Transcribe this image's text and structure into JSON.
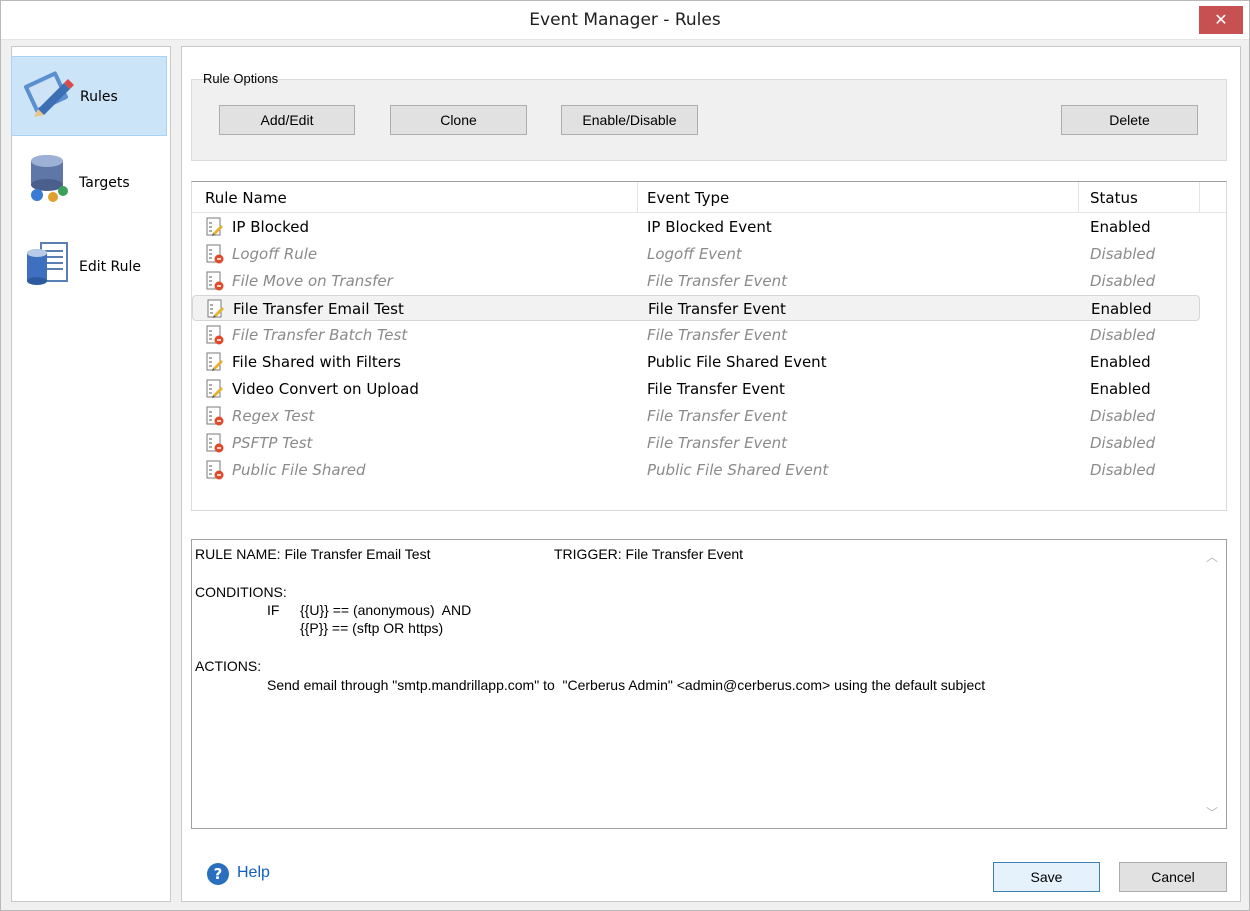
{
  "window": {
    "title": "Event Manager - Rules",
    "close_glyph": "✕"
  },
  "sidebar": {
    "items": [
      {
        "label": "Rules",
        "icon": "rules-pen-icon",
        "active": true
      },
      {
        "label": "Targets",
        "icon": "targets-database-icon",
        "active": false
      },
      {
        "label": "Edit Rule",
        "icon": "edit-rule-document-icon",
        "active": false
      }
    ]
  },
  "rule_options": {
    "group_label": "Rule Options",
    "add_edit": "Add/Edit",
    "clone": "Clone",
    "enable_disable": "Enable/Disable",
    "delete": "Delete"
  },
  "rules_list": {
    "columns": [
      "Rule Name",
      "Event Type",
      "Status"
    ],
    "rows": [
      {
        "name": "IP Blocked",
        "event": "IP Blocked Event",
        "status": "Enabled",
        "enabled": true,
        "selected": false
      },
      {
        "name": "Logoff Rule",
        "event": "Logoff Event",
        "status": "Disabled",
        "enabled": false,
        "selected": false
      },
      {
        "name": "File Move on Transfer",
        "event": "File Transfer Event",
        "status": "Disabled",
        "enabled": false,
        "selected": false
      },
      {
        "name": "File Transfer Email Test",
        "event": "File Transfer Event",
        "status": "Enabled",
        "enabled": true,
        "selected": true
      },
      {
        "name": "File Transfer Batch Test",
        "event": "File Transfer Event",
        "status": "Disabled",
        "enabled": false,
        "selected": false
      },
      {
        "name": "File Shared with Filters",
        "event": "Public File Shared Event",
        "status": "Enabled",
        "enabled": true,
        "selected": false
      },
      {
        "name": "Video Convert on Upload",
        "event": "File Transfer Event",
        "status": "Enabled",
        "enabled": true,
        "selected": false
      },
      {
        "name": "Regex Test",
        "event": "File Transfer Event",
        "status": "Disabled",
        "enabled": false,
        "selected": false
      },
      {
        "name": "PSFTP Test",
        "event": "File Transfer Event",
        "status": "Disabled",
        "enabled": false,
        "selected": false
      },
      {
        "name": "Public File Shared",
        "event": "Public File Shared Event",
        "status": "Disabled",
        "enabled": false,
        "selected": false
      }
    ]
  },
  "description": {
    "rule_name_line": "RULE NAME: File Transfer Email Test",
    "trigger_line": "TRIGGER: File Transfer Event",
    "conditions_label": "CONDITIONS:",
    "cond_if": "IF",
    "cond_1": "{{U}} == (anonymous)  AND",
    "cond_2": "{{P}} == (sftp OR https)",
    "actions_label": "ACTIONS:",
    "action_1": "Send email through \"smtp.mandrillapp.com\" to  \"Cerberus Admin\" <admin@cerberus.com> using the default subject"
  },
  "footer": {
    "help": "Help",
    "save": "Save",
    "cancel": "Cancel"
  },
  "colors": {
    "accent": "#cce4f7",
    "close": "#c75050",
    "disabled_text": "#8a8a8a",
    "link": "#1060c0"
  }
}
